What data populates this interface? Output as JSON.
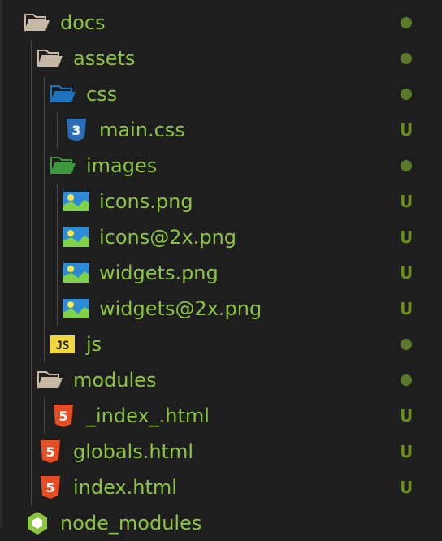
{
  "explorer": {
    "items": [
      {
        "label": "docs",
        "status": "dot",
        "icon": "folder-open-icon",
        "depth": 0
      },
      {
        "label": "assets",
        "status": "dot",
        "icon": "folder-open-icon",
        "depth": 1
      },
      {
        "label": "css",
        "status": "dot",
        "icon": "folder-blue-icon",
        "depth": 2
      },
      {
        "label": "main.css",
        "status": "U",
        "icon": "css3-icon",
        "depth": 3
      },
      {
        "label": "images",
        "status": "dot",
        "icon": "folder-green-icon",
        "depth": 2
      },
      {
        "label": "icons.png",
        "status": "U",
        "icon": "image-icon",
        "depth": 3
      },
      {
        "label": "icons@2x.png",
        "status": "U",
        "icon": "image-icon",
        "depth": 3
      },
      {
        "label": "widgets.png",
        "status": "U",
        "icon": "image-icon",
        "depth": 3
      },
      {
        "label": "widgets@2x.png",
        "status": "U",
        "icon": "image-icon",
        "depth": 3
      },
      {
        "label": "js",
        "status": "dot",
        "icon": "js-icon",
        "depth": 2
      },
      {
        "label": "modules",
        "status": "dot",
        "icon": "folder-open-icon",
        "depth": 1
      },
      {
        "label": "_index_.html",
        "status": "U",
        "icon": "html5-icon",
        "depth": 2
      },
      {
        "label": "globals.html",
        "status": "U",
        "icon": "html5-icon",
        "depth": 1
      },
      {
        "label": "index.html",
        "status": "U",
        "icon": "html5-icon",
        "depth": 1
      },
      {
        "label": "node_modules",
        "status": "",
        "icon": "nodejs-icon",
        "depth": 0
      }
    ]
  },
  "colors": {
    "label": "#8cc63f",
    "status": "#6b8e23",
    "folder": "#c8b8a6",
    "folder_blue": "#1e73be",
    "folder_green": "#3c9a3c",
    "css": "#2a6db5",
    "html": "#e44d26",
    "js": "#f0d73c",
    "background": "#1e1e1e"
  }
}
